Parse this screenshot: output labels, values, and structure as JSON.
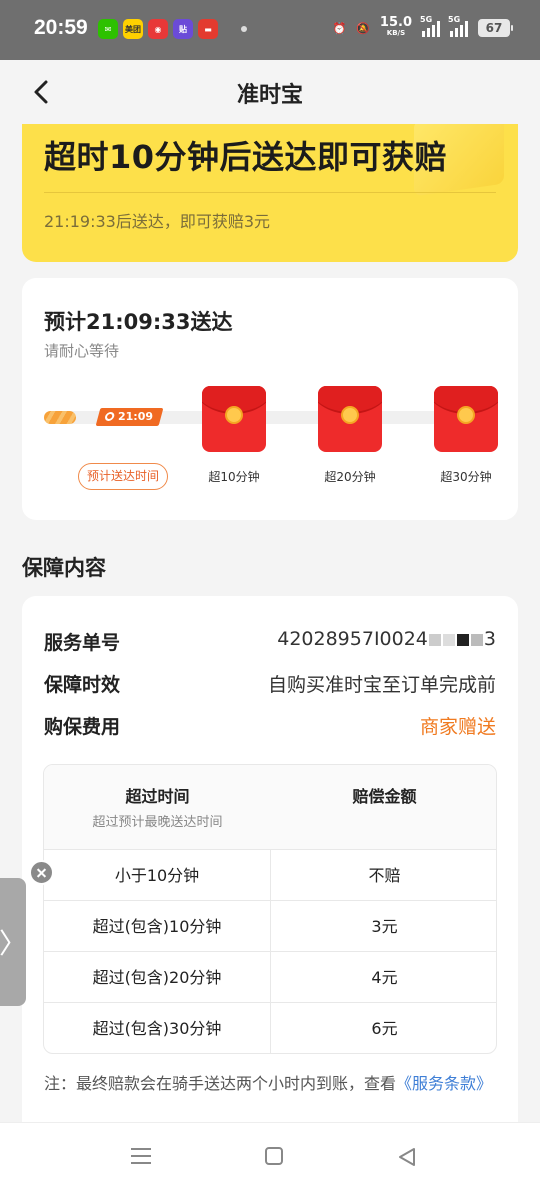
{
  "status_bar": {
    "time": "20:59",
    "speed_value": "15.0",
    "speed_unit": "KB/S",
    "signal_1": "5G",
    "signal_2": "5G",
    "battery": "67",
    "apps": [
      {
        "name": "wechat",
        "color": "#2dc100",
        "text": ""
      },
      {
        "name": "meituan",
        "color": "#ffd100",
        "text": "美团"
      },
      {
        "name": "app-red",
        "color": "#e83838",
        "text": ""
      },
      {
        "name": "app-purple",
        "color": "#6b4bd8",
        "text": "贴"
      },
      {
        "name": "app-red-2",
        "color": "#e33b2f",
        "text": ""
      }
    ]
  },
  "header": {
    "title": "准时宝"
  },
  "banner": {
    "title": "超时10分钟后送达即可获赔",
    "subtitle": "21:19:33后送达，即可获赔3元"
  },
  "timeline": {
    "title": "预计21:09:33送达",
    "subtitle": "请耐心等待",
    "marker_time": "21:09",
    "estimate_label": "预计送达时间",
    "milestones": [
      {
        "label": "超10分钟"
      },
      {
        "label": "超20分钟"
      },
      {
        "label": "超30分钟"
      }
    ]
  },
  "section": {
    "title": "保障内容"
  },
  "details": {
    "order_label": "服务单号",
    "order_value": "42028957I0024",
    "order_tail": "3",
    "period_label": "保障时效",
    "period_value": "自购买准时宝至订单完成前",
    "fee_label": "购保费用",
    "fee_value": "商家赠送"
  },
  "table": {
    "col1_header": "超过时间",
    "col1_sub": "超过预计最晚送达时间",
    "col2_header": "赔偿金额",
    "rows": [
      {
        "time": "小于10分钟",
        "amount": "不赔"
      },
      {
        "time": "超过(包含)10分钟",
        "amount": "3元"
      },
      {
        "time": "超过(包含)20分钟",
        "amount": "4元"
      },
      {
        "time": "超过(包含)30分钟",
        "amount": "6元"
      }
    ]
  },
  "note": {
    "text": "注：最终赔款会在骑手送达两个小时内到账，查看",
    "link": "《服务条款》"
  },
  "colors": {
    "accent_orange": "#f07a20",
    "banner_yellow": "#fde04a",
    "link_blue": "#3f7fd6",
    "redpack_red": "#ee2b2b"
  }
}
